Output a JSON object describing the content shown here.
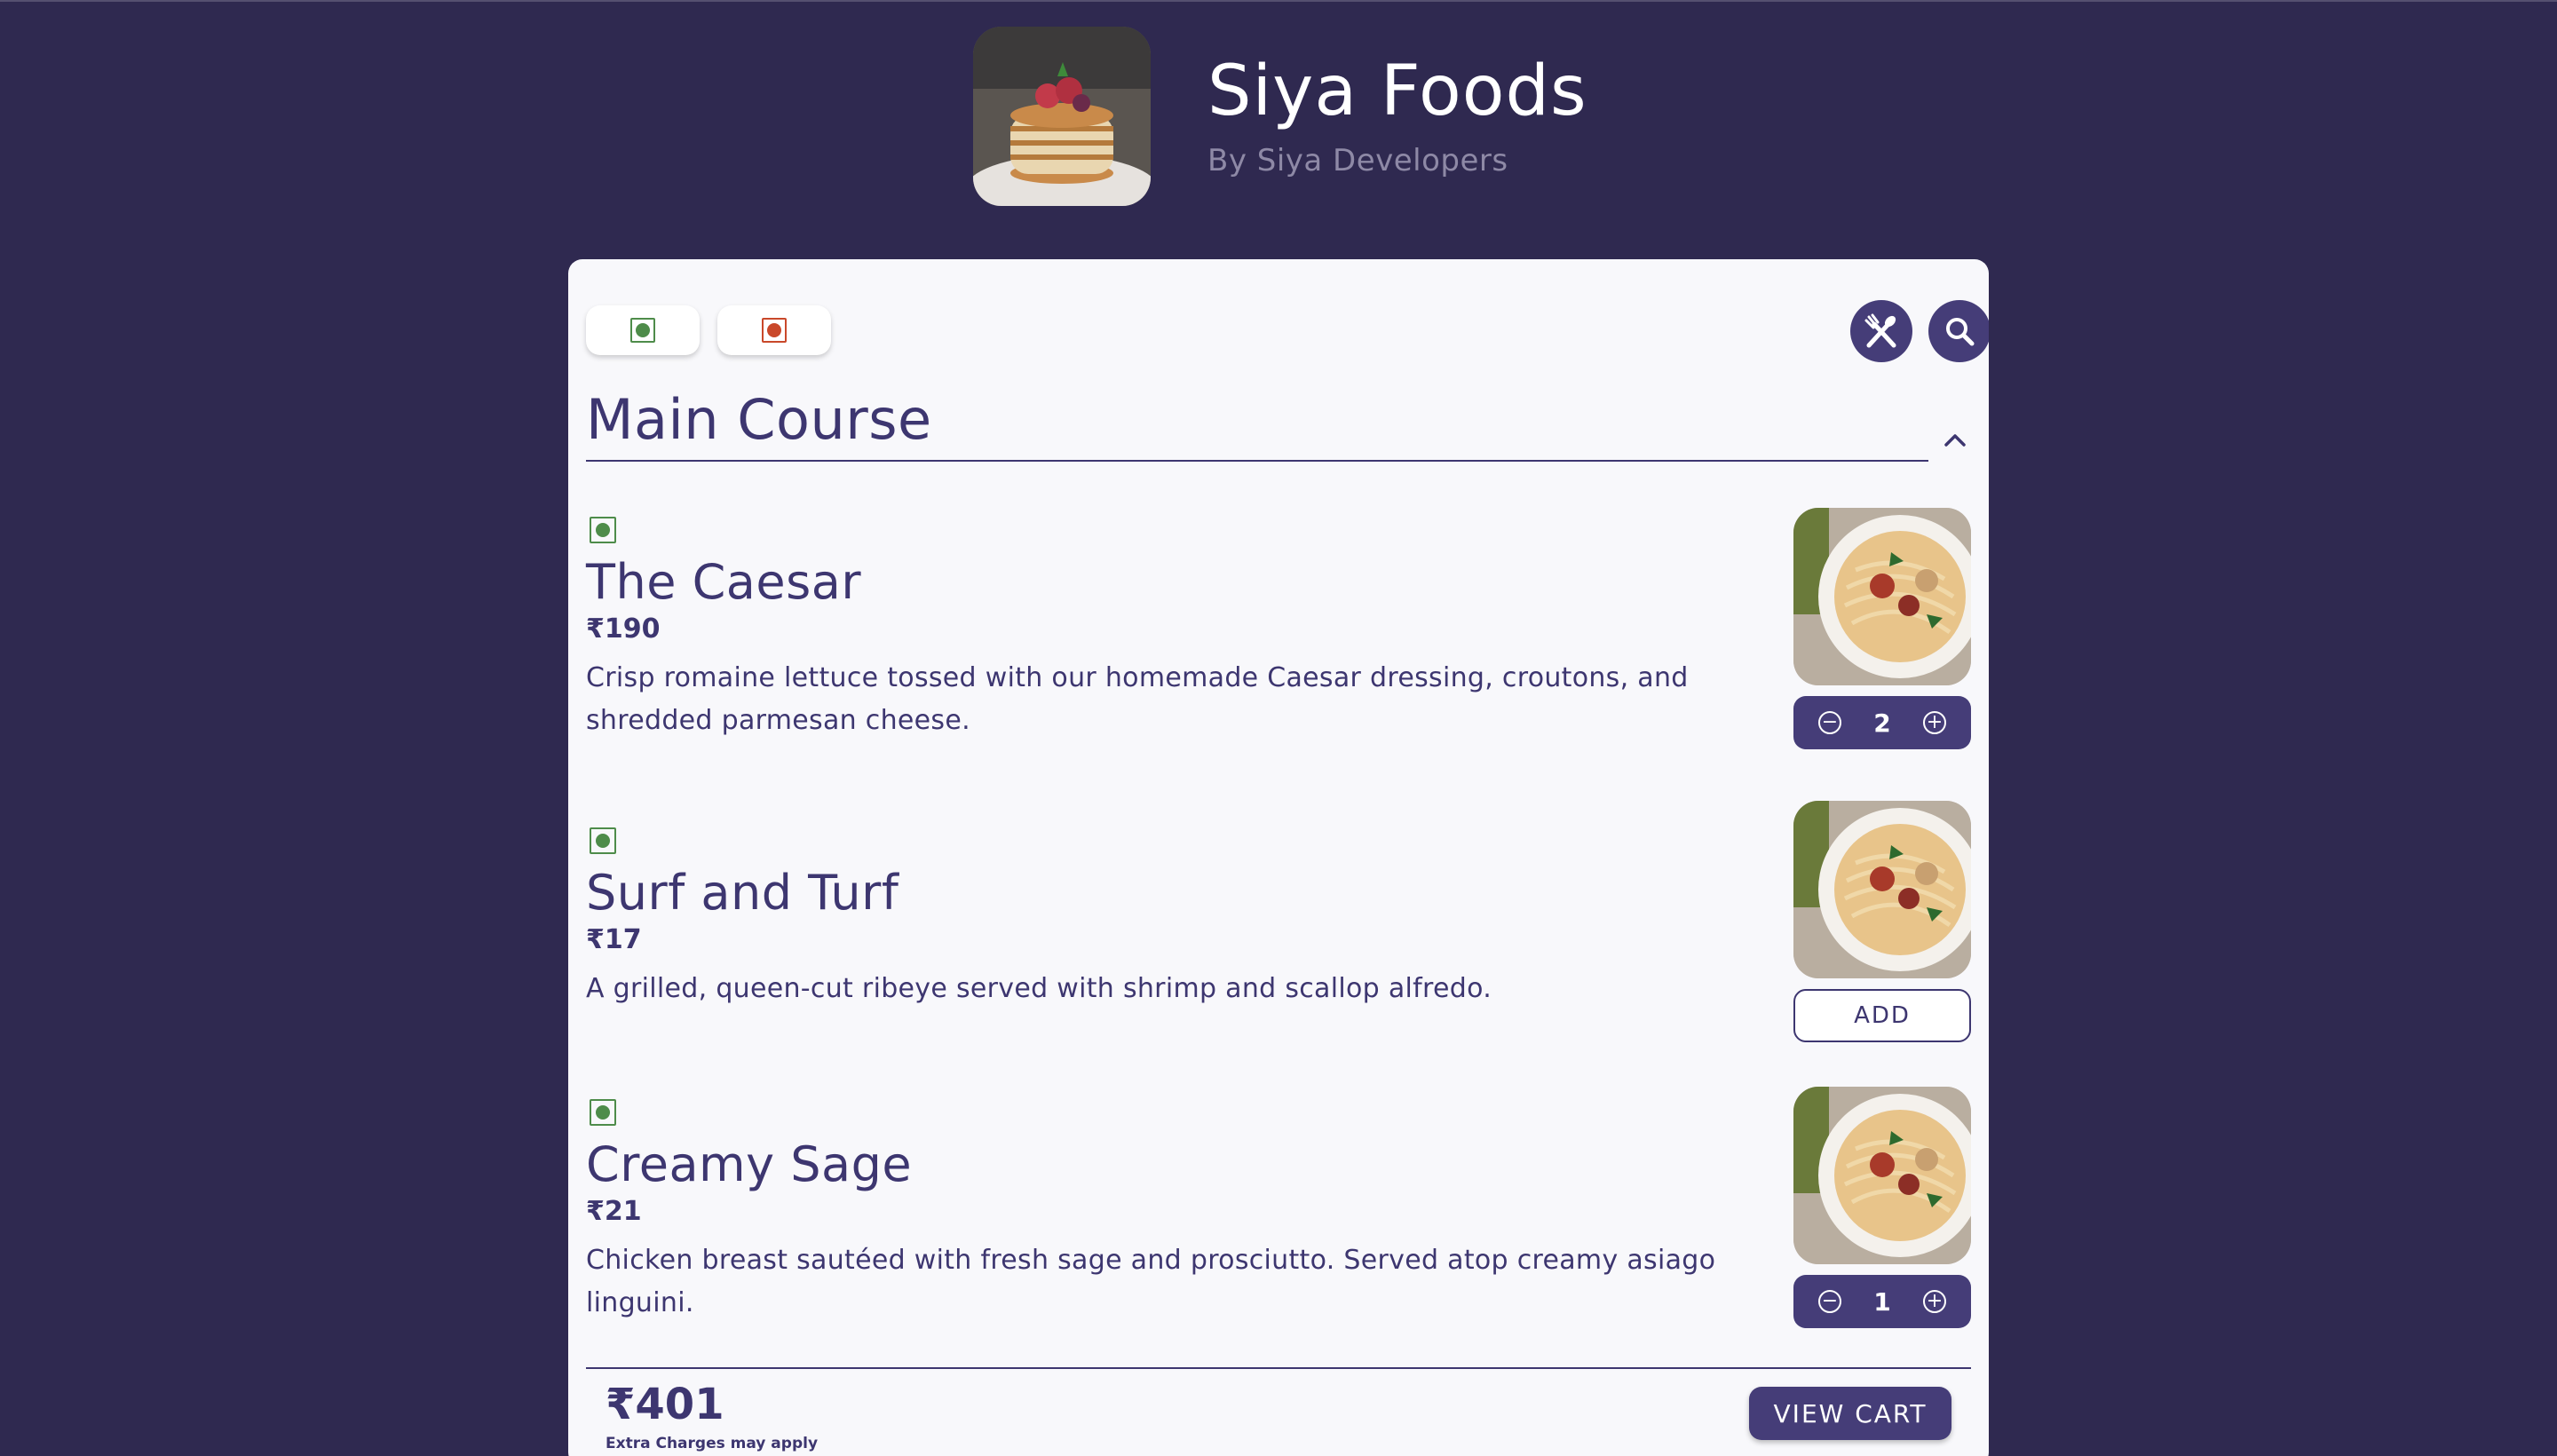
{
  "header": {
    "title": "Siya Foods",
    "subtitle": "By Siya Developers",
    "logo_icon": "pancake-stack-photo"
  },
  "toolbar": {
    "filters": [
      {
        "type": "veg",
        "color": "#4e8c4a"
      },
      {
        "type": "non-veg",
        "color": "#c9482a"
      }
    ],
    "menu_icon": "fork-spoon-icon",
    "search_icon": "search-icon"
  },
  "section": {
    "title": "Main Course",
    "toggle_icon": "chevron-up-icon"
  },
  "items": [
    {
      "name": "The Caesar",
      "price": "₹190",
      "description": "Crisp romaine lettuce tossed with our homemade Caesar dressing, croutons, and shredded parmesan cheese.",
      "diet": "veg",
      "quantity": "2",
      "photo_icon": "noodle-bowl-photo"
    },
    {
      "name": "Surf and Turf",
      "price": "₹17",
      "description": "A grilled, queen-cut ribeye served with shrimp and scallop alfredo.",
      "diet": "veg",
      "add_label": "ADD",
      "photo_icon": "noodle-bowl-photo"
    },
    {
      "name": "Creamy Sage",
      "price": "₹21",
      "description": "Chicken breast sautéed with fresh sage and prosciutto. Served atop creamy asiago linguini.",
      "diet": "veg",
      "quantity": "1",
      "photo_icon": "noodle-bowl-photo"
    }
  ],
  "footer": {
    "total": "₹401",
    "note": "Extra Charges may apply",
    "cart_label": "VIEW CART"
  },
  "colors": {
    "background": "#2f2950",
    "accent": "#453d78",
    "card": "#f8f8fb",
    "veg": "#4e8c4a",
    "nonveg": "#c9482a"
  }
}
